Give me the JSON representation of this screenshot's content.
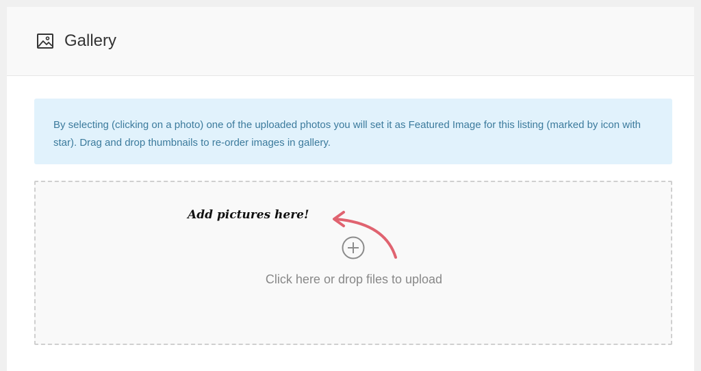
{
  "header": {
    "title": "Gallery",
    "icon": "image-icon"
  },
  "notice": {
    "text": "By selecting (clicking on a photo) one of the uploaded photos you will set it as Featured Image for this listing (marked by icon with star). Drag and drop thumbnails to re-order images in gallery."
  },
  "dropzone": {
    "upload_text": "Click here or drop files to upload",
    "upload_icon": "plus-circle-icon",
    "callout_text": "Add pictures here!",
    "callout_icon": "curved-arrow-icon"
  },
  "colors": {
    "notice_background": "#e1f2fc",
    "notice_text": "#3b7a9c",
    "arrow": "#e06370"
  }
}
